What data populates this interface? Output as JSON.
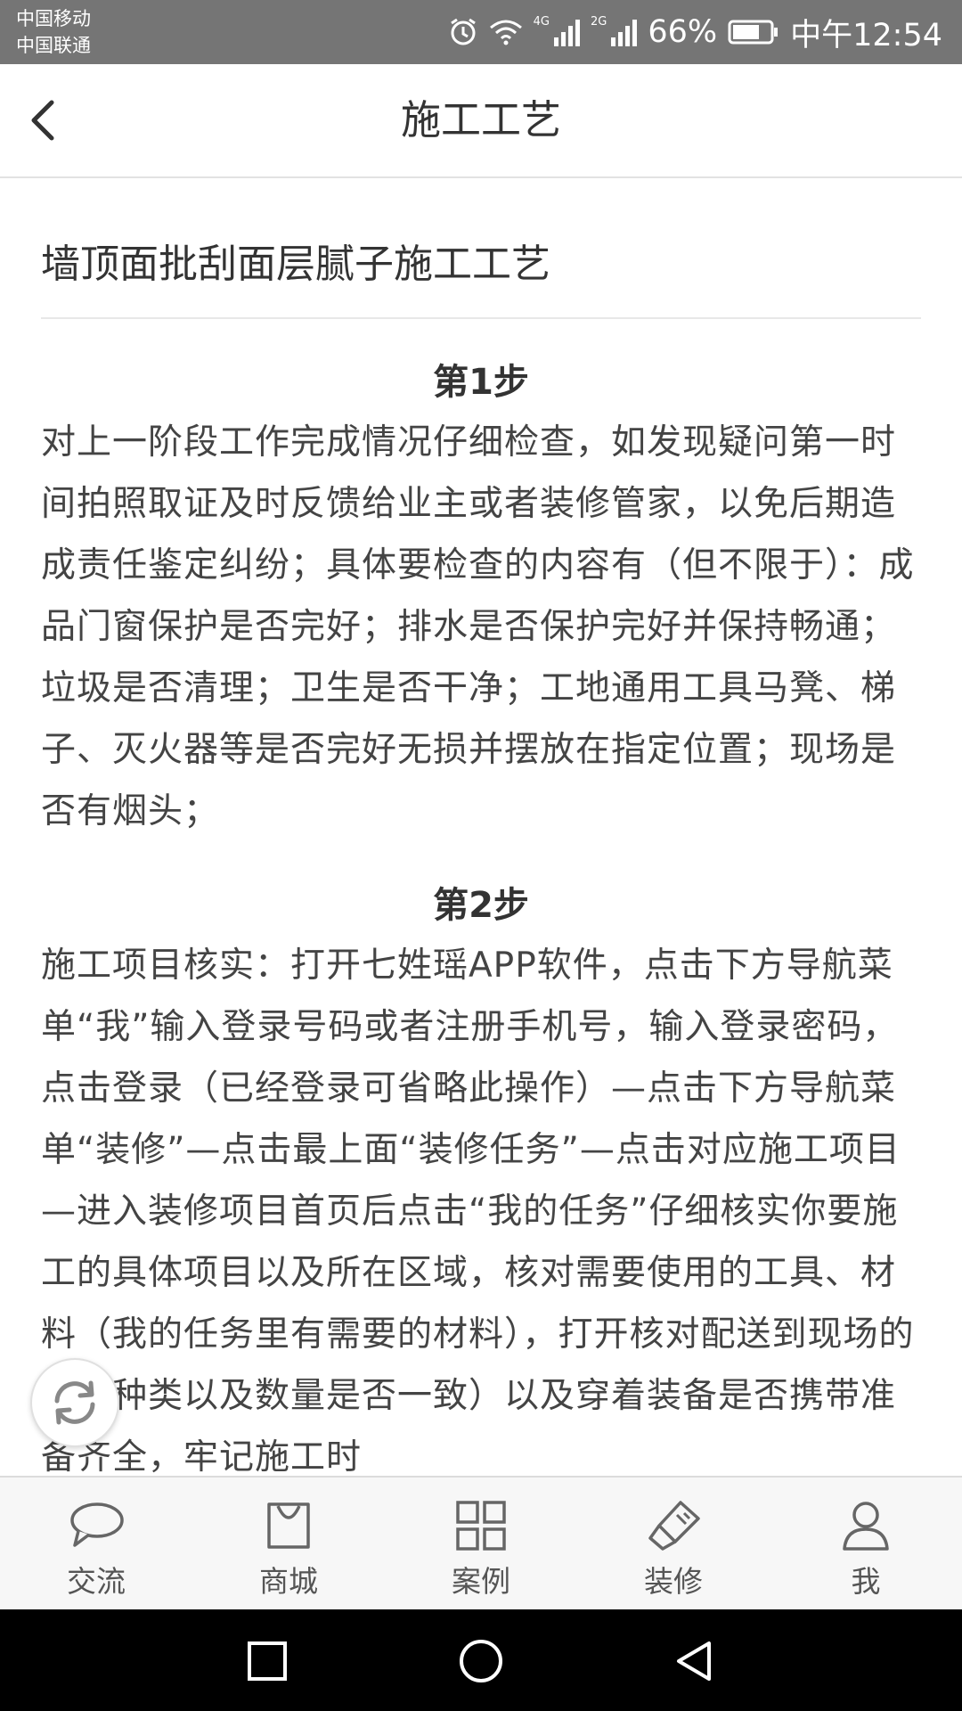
{
  "status_bar": {
    "carrier_1": "中国移动",
    "carrier_2": "中国联通",
    "net_1": "4G",
    "net_2": "2G",
    "battery": "66%",
    "time": "中午12:54"
  },
  "header": {
    "title": "施工工艺"
  },
  "article": {
    "title": "墙顶面批刮面层腻子施工工艺",
    "steps": [
      {
        "title": "第1步",
        "text": "对上一阶段工作完成情况仔细检查，如发现疑问第一时间拍照取证及时反馈给业主或者装修管家，以免后期造成责任鉴定纠纷；具体要检查的内容有（但不限于）：成品门窗保护是否完好；排水是否保护完好并保持畅通；垃圾是否清理；卫生是否干净；工地通用工具马凳、梯子、灭火器等是否完好无损并摆放在指定位置；现场是否有烟头；"
      },
      {
        "title": "第2步",
        "text": "施工项目核实：打开七姓瑶APP软件，点击下方导航菜单“我”输入登录号码或者注册手机号，输入登录密码，点击登录（已经登录可省略此操作）—点击下方导航菜单“装修”—点击最上面“装修任务”—点击对应施工项目—进入装修项目首页后点击“我的任务”仔细核实你要施工的具体项目以及所在区域，核对需要使用的工具、材料（我的任务里有需要的材料），打开核对配送到现场的商品种类以及数量是否一致）以及穿着装备是否携带准备齐全，牢记施工时"
      }
    ]
  },
  "tabbar": {
    "items": [
      {
        "label": "交流",
        "icon": "chat-icon"
      },
      {
        "label": "商城",
        "icon": "shopping-bag-icon"
      },
      {
        "label": "案例",
        "icon": "grid-icon"
      },
      {
        "label": "装修",
        "icon": "paint-brush-icon"
      },
      {
        "label": "我",
        "icon": "user-icon"
      }
    ]
  },
  "colors": {
    "status_bar_bg": "#757575",
    "tab_bar_bg": "#f7f7f7",
    "nav_bar_bg": "#000000"
  }
}
